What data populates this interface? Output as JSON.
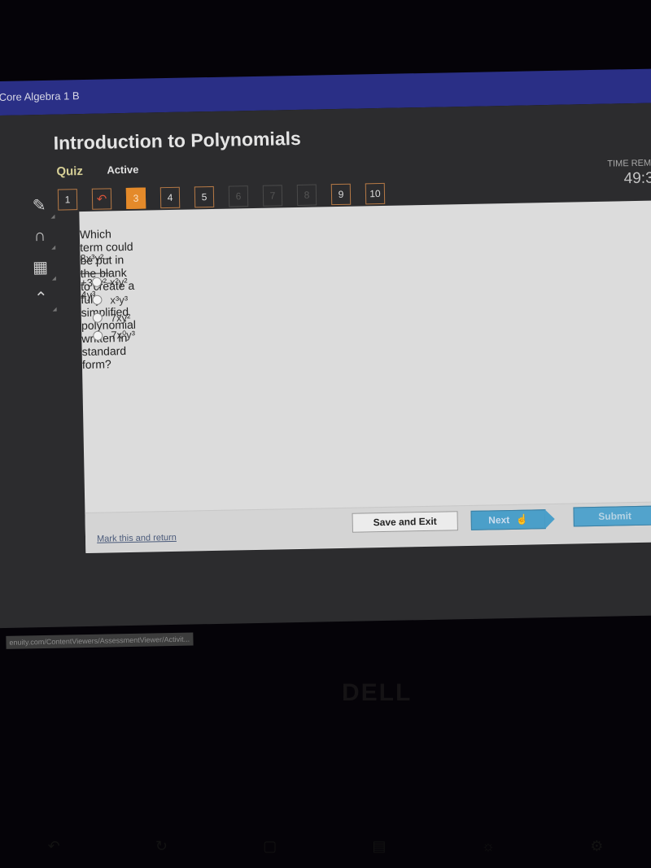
{
  "header": {
    "course_title": "Core Algebra 1 B"
  },
  "activity": {
    "title": "Introduction to Polynomials",
    "type": "Quiz",
    "status": "Active",
    "timer_label": "TIME REM",
    "timer_value": "49:3"
  },
  "tools": [
    {
      "icon": "pencil-icon"
    },
    {
      "icon": "headphones-icon"
    },
    {
      "icon": "calculator-icon"
    },
    {
      "icon": "collapse-up-icon"
    }
  ],
  "question_nav": [
    {
      "label": "1",
      "state": "answered"
    },
    {
      "label": "↶",
      "state": "back"
    },
    {
      "label": "3",
      "state": "current"
    },
    {
      "label": "4",
      "state": "answered"
    },
    {
      "label": "5",
      "state": "answered"
    },
    {
      "label": "6",
      "state": "disabled"
    },
    {
      "label": "7",
      "state": "disabled"
    },
    {
      "label": "8",
      "state": "disabled"
    },
    {
      "label": "9",
      "state": "answered"
    },
    {
      "label": "10",
      "state": "answered"
    }
  ],
  "question": {
    "prompt": "Which term could be put in the blank to create a fully simplified polynomial written in standard form?",
    "expression_start": "8x³y²–",
    "expression_end": "+3xy²–4y³",
    "options": [
      {
        "label": "x²y²",
        "selected": false
      },
      {
        "label": "x³y³",
        "selected": false
      },
      {
        "label": "7xy²",
        "selected": false
      },
      {
        "label": "7x⁰y³",
        "selected": false
      }
    ]
  },
  "footer": {
    "mark_link": "Mark this and return",
    "save_exit": "Save and Exit",
    "next": "Next",
    "submit": "Submit"
  },
  "status_url": "enuity.com/ContentViewers/AssessmentViewer/Activit...",
  "device_brand": "DELL"
}
